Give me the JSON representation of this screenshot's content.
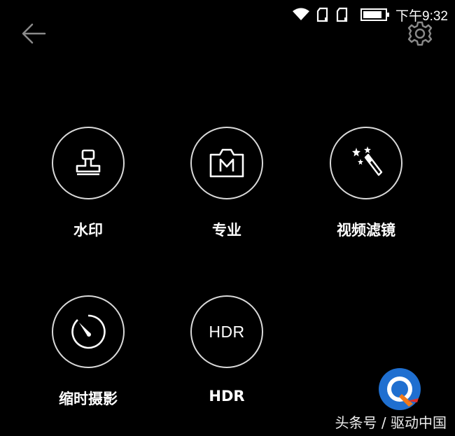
{
  "status_bar": {
    "time": "下午9:32",
    "icons": [
      "wifi-icon",
      "sim1-icon",
      "sim2-icon",
      "battery-icon"
    ]
  },
  "header": {
    "back_icon": "arrow-left-icon",
    "settings_icon": "gear-icon"
  },
  "modes": [
    {
      "label": "水印",
      "icon": "stamp-icon"
    },
    {
      "label": "专业",
      "icon": "camera-m-icon"
    },
    {
      "label": "视频滤镜",
      "icon": "magic-wand-icon"
    },
    {
      "label": "缩时摄影",
      "icon": "timer-icon"
    },
    {
      "label": "HDR",
      "icon": "hdr-icon",
      "icon_text": "HDR"
    }
  ],
  "watermark": {
    "text": "头条号 / 驱动中国"
  },
  "colors": {
    "background": "#000000",
    "circle_border": "#d9d9d9",
    "icon_stroke": "#ffffff",
    "wand_accent": "#ffffff",
    "logo_blue": "#1f6fd0",
    "logo_orange": "#f07a1a",
    "logo_red": "#e0302a"
  }
}
